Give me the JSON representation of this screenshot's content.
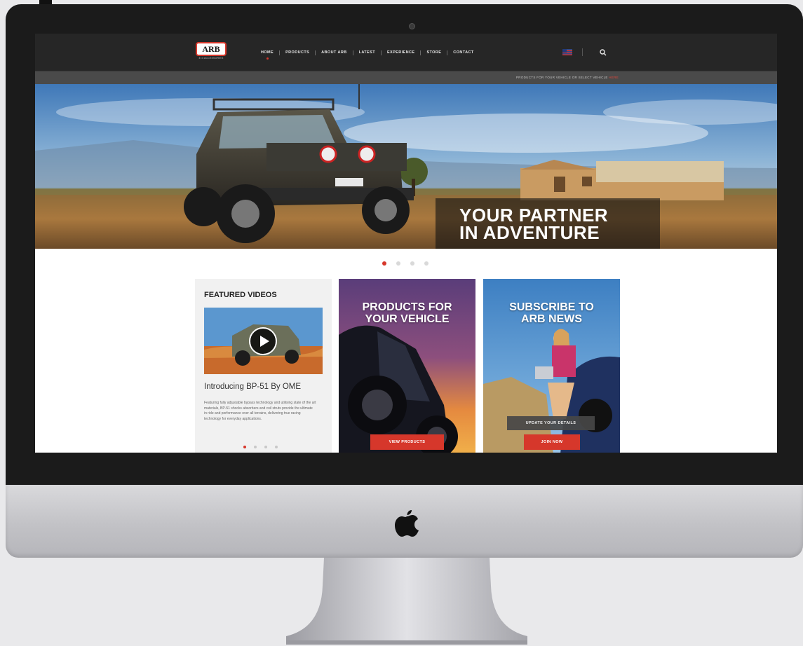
{
  "nav": {
    "logo": "ARB",
    "logo_sub": "4×4 ACCESSORIES",
    "items": [
      "HOME",
      "PRODUCTS",
      "ABOUT ARB",
      "LATEST",
      "EXPERIENCE",
      "STORE",
      "CONTACT"
    ],
    "active": "HOME"
  },
  "promo": {
    "text": "PRODUCTS FOR YOUR VEHICLE OR SELECT VEHICLE",
    "link": "HERE"
  },
  "hero": {
    "caption_line1": "YOUR PARTNER",
    "caption_line2": "IN ADVENTURE",
    "slide_count": 4,
    "active_slide": 1
  },
  "featured_videos": {
    "title": "FEATURED VIDEOS",
    "video_title": "Introducing BP-51 By OME",
    "description": "Featuring fully adjustable bypass technology and utilising state of the art materials, BP-51 shocks absorbers and coil struts provide the ultimate in ride and performance over all terrains, delivering true racing technology for everyday applications.",
    "page_count": 4,
    "active_page": 1
  },
  "products_card": {
    "title_line1": "PRODUCTS FOR",
    "title_line2": "YOUR VEHICLE",
    "button": "VIEW PRODUCTS"
  },
  "subscribe_card": {
    "title_line1": "SUBSCRIBE TO",
    "title_line2": "ARB NEWS",
    "secondary_button": "UPDATE YOUR DETAILS",
    "primary_button": "JOIN NOW"
  },
  "colors": {
    "brand_red": "#d6372b",
    "header_bg": "#262626",
    "promo_bar_bg": "#4a4a4a"
  },
  "icons": [
    "apple-logo-icon",
    "search-icon",
    "flag-icon",
    "play-icon",
    "camera-icon"
  ]
}
